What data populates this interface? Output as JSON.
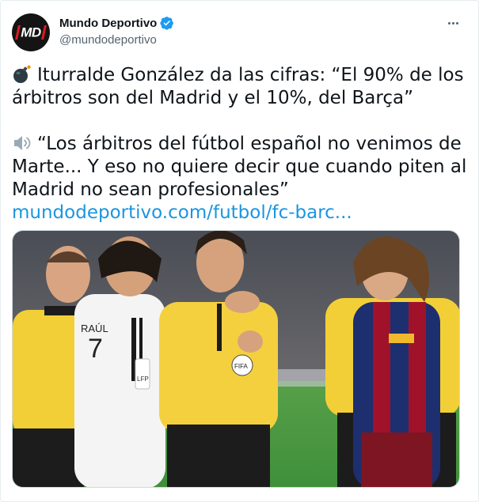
{
  "account": {
    "display_name": "Mundo Deportivo",
    "handle": "@mundodeportivo",
    "avatar_text": "MD",
    "verified": true
  },
  "tweet": {
    "line1": "Iturralde González da las cifras: “El 90% de los árbitros son del Madrid y el 10%, del Barça”",
    "line2": "“Los árbitros del fútbol español no venimos de Marte... Y eso no quiere decir que cuando piten al Madrid no sean profesionales”",
    "link": "mundodeportivo.com/futbol/fc-barc...",
    "emoji1": "bomb-icon",
    "emoji2": "speaker-icon"
  },
  "media": {
    "jersey_text": "RAÚL",
    "jersey_number": "7",
    "badge_text": "LFP",
    "referee_badge": "FIFA"
  },
  "colors": {
    "link": "#1b95e0",
    "verified": "#1d9bf0",
    "referee_yellow": "#f4d03f",
    "pitch_green": "#3f8f3a"
  }
}
